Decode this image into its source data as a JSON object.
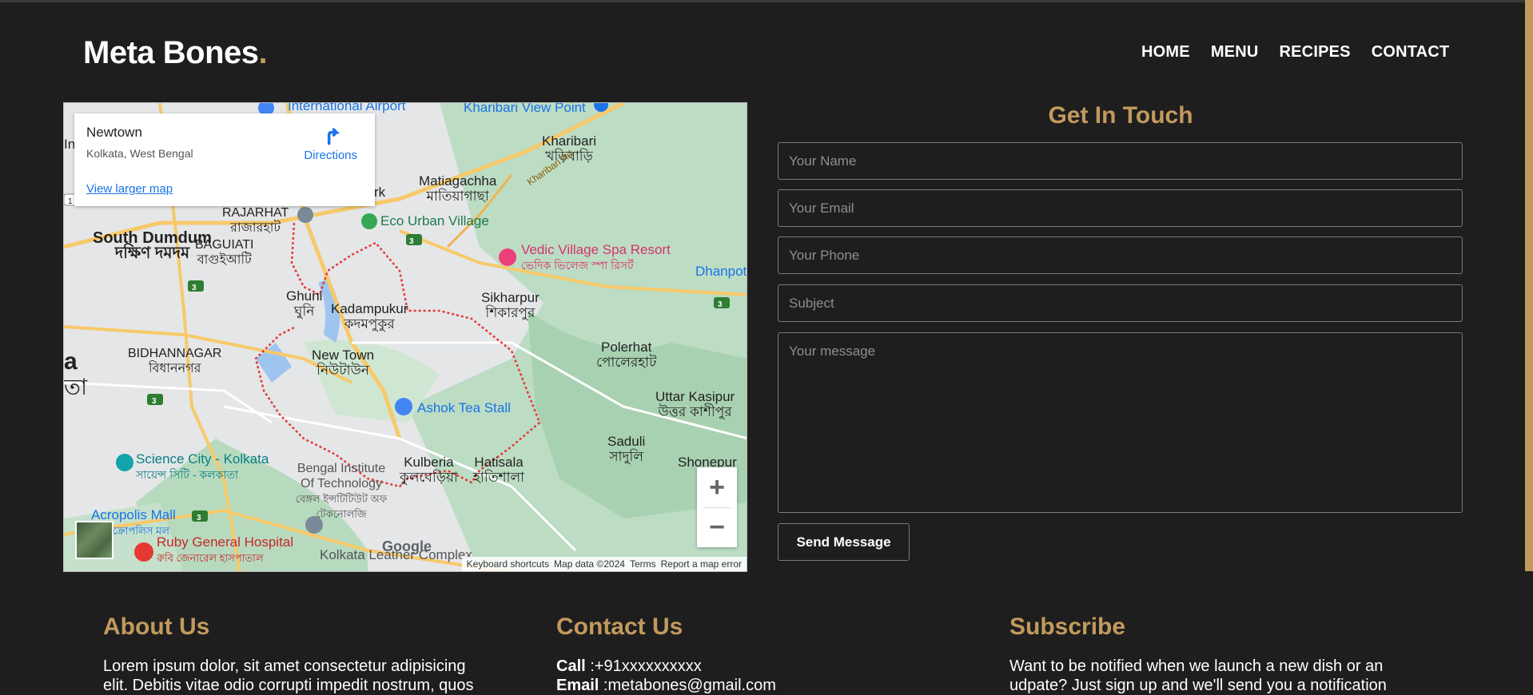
{
  "brand": {
    "name": "Meta Bones",
    "dot": "."
  },
  "nav": [
    "HOME",
    "MENU",
    "RECIPES",
    "CONTACT"
  ],
  "map": {
    "info": {
      "title": "Newtown",
      "subtitle": "Kolkata, West Bengal",
      "link": "View larger map",
      "directions": "Directions"
    },
    "labels": {
      "international_airport": "International Airport",
      "kharibari_view_point": "Kharibari View Point",
      "kharibari": "Kharibari",
      "kharibari_bn": "খড়িবাড়ি",
      "matiagachha": "Matiagachha",
      "matiagachha_bn": "মাতিয়াগাছা",
      "kharibari_rd": "Kharibari Rd",
      "rajarhat": "RAJARHAT",
      "rajarhat_bn": "রাজারহাট",
      "eco_urban_village": "Eco Urban Village",
      "south_dumdum": "South Dumdum",
      "south_dumdum_bn": "দক্ষিণ দমদম",
      "baguiati": "BAGUIATI",
      "baguiati_bn": "বাগুইআটি",
      "vedic_village": "Vedic Village Spa Resort",
      "vedic_village_bn": "ভেদিক ভিলেজ স্পা রিসর্ট",
      "dhanpota": "Dhanpota",
      "ghuni": "Ghuni",
      "ghuni_bn": "ঘুনি",
      "kadampukur": "Kadampukur",
      "kadampukur_bn": "কদমপুকুর",
      "sikharpur": "Sikharpur",
      "sikharpur_bn": "শিকারপুর",
      "bidhannagar": "BIDHANNAGAR",
      "bidhannagar_bn": "বিধাননগর",
      "new_town": "New Town",
      "new_town_bn": "নিউটাউন",
      "polerhat": "Polerhat",
      "polerhat_bn": "পোলেরহাট",
      "ashok_tea_stall": "Ashok Tea Stall",
      "uttar_kasipur": "Uttar Kasipur",
      "uttar_kasipur_bn": "উত্তর কাশীপুর",
      "saduli": "Saduli",
      "saduli_bn": "সাদুলি",
      "science_city": "Science City - Kolkata",
      "science_city_bn": "সায়েন্স সিটি - কলকাতা",
      "bengal_institute": "Bengal Institute Of Technology",
      "bengal_institute_bn": "বেঙ্গল ইন্সটিটিউট অফ টেকনোলজি",
      "kulberia": "Kulberia",
      "kulberia_bn": "কুলবেড়িয়া",
      "hatisala": "Hatisala",
      "hatisala_bn": "হাতিশালা",
      "shonepur": "Shonepur",
      "acropolis_mall": "Acropolis Mall",
      "acropolis_mall_bn": "অ্যাক্রোপলিস মল",
      "ruby_hospital": "Ruby General Hospital",
      "ruby_hospital_bn": "রুবি জেনারেল হাসপাতাল",
      "kolkata_leather": "Kolkata Leather Complex",
      "edge_a": "a",
      "edge_bn": "তা",
      "edge_n": "In",
      "edge_rk": "rk",
      "shield_1": "1",
      "shield_3": "3"
    },
    "google": "Google",
    "attribution": [
      "Keyboard shortcuts",
      "Map data ©2024",
      "Terms",
      "Report a map error"
    ],
    "zoom_in": "+",
    "zoom_out": "−"
  },
  "contact_form": {
    "heading": "Get In Touch",
    "name_placeholder": "Your Name",
    "email_placeholder": "Your Email",
    "phone_placeholder": "Your Phone",
    "subject_placeholder": "Subject",
    "message_placeholder": "Your message",
    "send_label": "Send Message"
  },
  "footer": {
    "about": {
      "heading": "About Us",
      "text": "Lorem ipsum dolor, sit amet consectetur adipisicing elit. Debitis vitae odio corrupti impedit nostrum, quos"
    },
    "contact": {
      "heading": "Contact Us",
      "call_label": "Call",
      "call_value": ":+91xxxxxxxxxx",
      "email_label": "Email",
      "email_value": ":metabones@gmail.com"
    },
    "subscribe": {
      "heading": "Subscribe",
      "text": "Want to be notified when we launch a new dish or an udpate? Just sign up and we'll send you a notification"
    }
  },
  "colors": {
    "accent": "#c29a5d",
    "background": "#1e1e1e",
    "link": "#1a73e8"
  }
}
